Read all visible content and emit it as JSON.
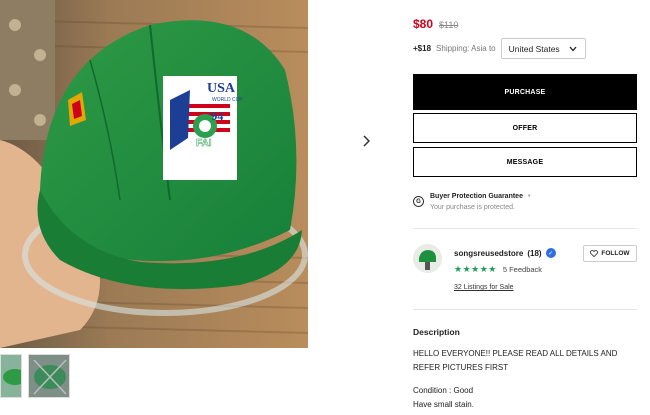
{
  "listing": {
    "price": "$80",
    "original_price": "$110"
  },
  "shipping": {
    "cost": "+$18",
    "label": "Shipping: Asia to",
    "country": "United States"
  },
  "buttons": {
    "purchase": "PURCHASE",
    "offer": "OFFER",
    "message": "MESSAGE"
  },
  "protection": {
    "title": "Buyer Protection Guarantee",
    "dot": "•",
    "subtitle": "Your purchase is protected."
  },
  "seller": {
    "name": "songsreusedstore",
    "rating_count": "(18)",
    "stars": "★★★★★",
    "feedback": "5 Feedback",
    "listings": "32 Listings for Sale",
    "follow": "FOLLOW"
  },
  "description": {
    "title": "Description",
    "lines": [
      "HELLO EVERYONE!! PLEASE READ ALL DETAILS AND",
      "REFER PICTURES FIRST",
      "Condition : Good",
      "Have small stain."
    ]
  },
  "product_photo": {
    "patch_text_1": "USA",
    "patch_text_2": "WORLD CUP",
    "patch_text_3": "'94",
    "patch_text_4": "FAI"
  }
}
